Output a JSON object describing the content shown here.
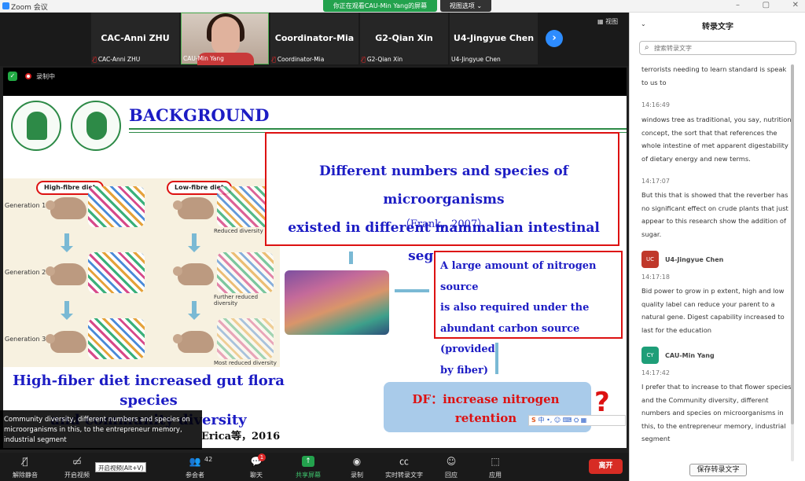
{
  "app": {
    "title": "Zoom 会议",
    "banner": "你正在观看CAU-Min Yang的屏幕",
    "view_options": "视图选项 ⌄"
  },
  "gallery": {
    "tiles": [
      {
        "name": "CAC-Anni ZHU",
        "label": "CAC-Anni ZHU",
        "muted": true
      },
      {
        "name": "",
        "label": "CAU-Min Yang",
        "muted": false
      },
      {
        "name": "Coordinator-Mia",
        "label": "Coordinator-Mia",
        "muted": true
      },
      {
        "name": "G2-Qian Xin",
        "label": "G2-Qian Xin",
        "muted": true
      },
      {
        "name": "U4-Jingyue Chen",
        "label": "U4-Jingyue Chen",
        "muted": false
      }
    ],
    "view_button": "视图",
    "next_icon": "chevron-right-icon"
  },
  "recording": {
    "label": "录制中"
  },
  "slide": {
    "title": "BACKGROUND",
    "box1": {
      "line1": "Different numbers and species of microorganisms",
      "line2": "existed in different mammalian intestinal segments",
      "citation": "（Frank，2007）"
    },
    "mice": {
      "high_label": "High-fibre diet",
      "low_label": "Low-fibre diet",
      "generations": [
        "Generation 1",
        "Generation 2",
        "Generation 3"
      ],
      "diversity": [
        "Reduced diversity",
        "Further reduced diversity",
        "Most reduced diversity"
      ]
    },
    "box2": {
      "line1": "A large amount of nitrogen source",
      "line2": "is also required under the",
      "line3": "abundant carbon source (provided",
      "line4": "by fiber)"
    },
    "box3": {
      "line1": "DF：increase nitrogen",
      "line2": "retention"
    },
    "conclusion": {
      "line1": "High-fiber diet increased gut flora species",
      "line2": "and community diversity"
    },
    "citation2": "Erica等，2016",
    "ime": "中 •, ☺ ⌨ ⛭ ▦"
  },
  "caption": "Community diversity, different numbers and species on microorganisms in this, to the entrepreneur memory, industrial segment",
  "toolbar": {
    "unmute": "解除静音",
    "video": "开启视频",
    "participants": "参会者",
    "participants_count": "42",
    "chat": "聊天",
    "chat_badge": "1",
    "share": "共享屏幕",
    "record": "录制",
    "transcript": "实时转录文字",
    "reactions": "回应",
    "apps": "应用",
    "leave": "离开",
    "tooltip": "开启视频(Alt+V)"
  },
  "panel": {
    "title": "转录文字",
    "search_placeholder": "搜索转录文字",
    "entries": [
      {
        "time": "",
        "text": "terrorists needing to learn standard is speak to us to"
      },
      {
        "time": "14:16:49",
        "text": "windows tree as traditional, you say, nutrition concept, the sort that that references the whole intestine of met apparent digestability of dietary energy and new terms."
      },
      {
        "time": "14:17:07",
        "text": "But this that is showed that the reverber has no significant effect on crude plants that just appear to this research show the addition of sugar."
      },
      {
        "speaker": "U4-Jingyue Chen",
        "initials": "UC",
        "color": "#c0392b",
        "time": "14:17:18",
        "text": "Bid power to grow in p extent, high and low quality label can reduce your parent to a natural gene. Digest capability increased to last for the education"
      },
      {
        "speaker": "CAU-Min Yang",
        "initials": "CY",
        "color": "#1e9e78",
        "time": "14:17:42",
        "text": "I prefer that to increase to that flower species and the Community diversity, different numbers and species on microorganisms in this, to the entrepreneur memory, industrial segment"
      }
    ],
    "save_button": "保存转录文字"
  }
}
